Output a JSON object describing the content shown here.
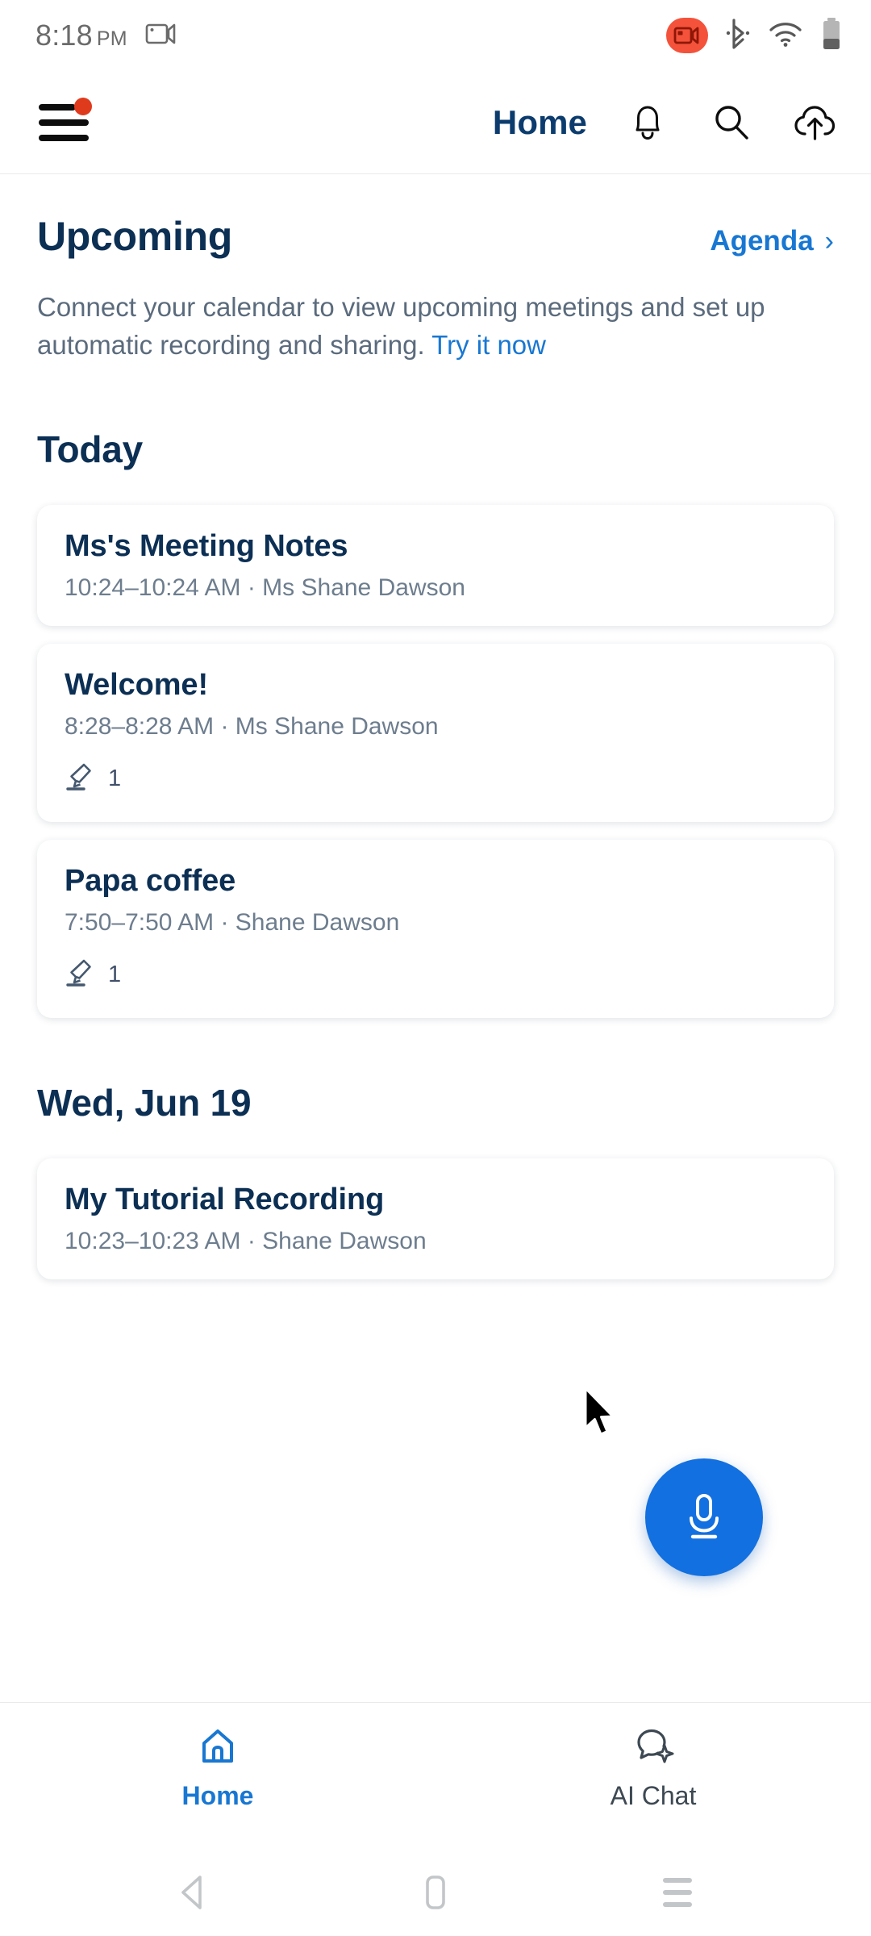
{
  "status_bar": {
    "time": "8:18",
    "ampm": "PM",
    "icons": {
      "screen_record": "video-camera-icon",
      "recording_indicator": "recording-video-icon",
      "bluetooth": "bluetooth-icon",
      "wifi": "wifi-icon",
      "battery": "battery-icon"
    },
    "accent_red": "#f4523b"
  },
  "header": {
    "title": "Home",
    "menu_icon": "hamburger-menu-icon",
    "menu_badge": true,
    "badge_color": "#e03a1d",
    "title_color": "#0c3c6e",
    "actions": [
      {
        "name": "notifications-icon"
      },
      {
        "name": "search-icon"
      },
      {
        "name": "cloud-upload-icon"
      }
    ]
  },
  "upcoming": {
    "heading": "Upcoming",
    "agenda_label": "Agenda",
    "agenda_chevron": "›",
    "description_before": "Connect your calendar to view upcoming meetings and set up automatic recording and sharing. ",
    "description_link": "Try it now",
    "link_color": "#1877d2"
  },
  "sections": [
    {
      "day_label": "Today",
      "cards": [
        {
          "title": "Ms's Meeting Notes",
          "subtitle": "10:24–10:24 AM ·  Ms Shane Dawson",
          "has_meta": false,
          "meta_icon": "highlighter-icon",
          "meta_count": ""
        },
        {
          "title": "Welcome!",
          "subtitle": "8:28–8:28 AM ·  Ms Shane Dawson",
          "has_meta": true,
          "meta_icon": "highlighter-icon",
          "meta_count": "1"
        },
        {
          "title": "Papa coffee",
          "subtitle": "7:50–7:50 AM ·  Shane Dawson",
          "has_meta": true,
          "meta_icon": "highlighter-icon",
          "meta_count": "1"
        }
      ]
    },
    {
      "day_label": "Wed, Jun 19",
      "cards": [
        {
          "title": "My Tutorial Recording",
          "subtitle": "10:23–10:23 AM ·  Shane Dawson",
          "has_meta": false,
          "meta_icon": "highlighter-icon",
          "meta_count": ""
        }
      ]
    }
  ],
  "fab": {
    "icon": "microphone-icon",
    "color": "#1270e0"
  },
  "cursor": {
    "icon": "mouse-pointer-icon"
  },
  "bottom_nav": {
    "items": [
      {
        "label": "Home",
        "icon": "home-icon",
        "active": true
      },
      {
        "label": "AI Chat",
        "icon": "ai-chat-bubble-icon",
        "active": false
      }
    ],
    "active_color": "#1877d2"
  },
  "system_nav": {
    "back": "back-triangle-icon",
    "home": "home-square-icon",
    "recents": "recents-lines-icon"
  }
}
